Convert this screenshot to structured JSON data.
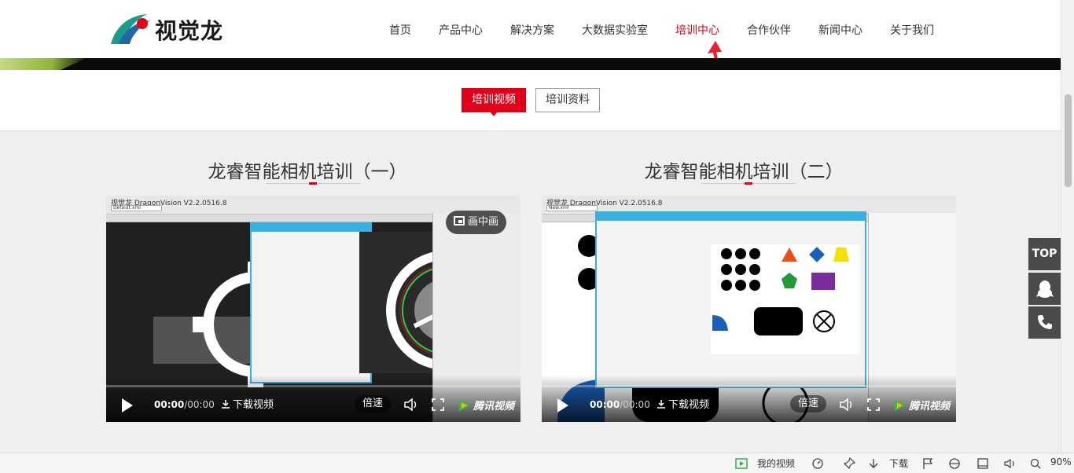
{
  "header": {
    "logo_text": "视觉龙",
    "nav": [
      {
        "label": "首页"
      },
      {
        "label": "产品中心"
      },
      {
        "label": "解决方案"
      },
      {
        "label": "大数据实验室"
      },
      {
        "label": "培训中心",
        "active": true
      },
      {
        "label": "合作伙伴"
      },
      {
        "label": "新闻中心"
      },
      {
        "label": "关于我们"
      }
    ]
  },
  "tabs": {
    "video": "培训视频",
    "material": "培训资料"
  },
  "videos": [
    {
      "title": "龙睿智能相机培训（一）",
      "time_current": "00:00",
      "time_total": "/00:00",
      "download": "下载视频",
      "speed": "倍速",
      "pip": "画中画",
      "brand": "腾讯视频"
    },
    {
      "title": "龙睿智能相机培训（二）",
      "time_current": "00:00",
      "time_total": "/00:00",
      "download": "下载视频",
      "speed": "倍速",
      "brand": "腾讯视频"
    }
  ],
  "video_screens": [
    {
      "app": "视觉龙 DragonVision V2.2.0516.8",
      "file": "Default.xml"
    },
    {
      "app": "视觉龙 DragonVision V2.2.0516.8",
      "file": "New.xml"
    }
  ],
  "float": {
    "top": "TOP"
  },
  "statusbar": {
    "my_video": "我的视频",
    "download": "下载",
    "zoom": "90%"
  },
  "colors": {
    "accent": "#e1001a",
    "float_bg": "#4b4b4b",
    "dialog_border": "#39b1e0"
  }
}
